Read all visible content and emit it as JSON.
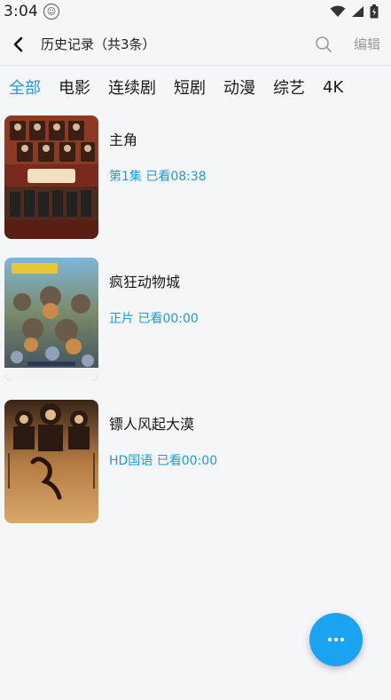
{
  "status_bar": {
    "time": "3:04"
  },
  "header": {
    "title": "历史记录（共3条）",
    "edit_label": "编辑"
  },
  "tabs": [
    {
      "label": "全部",
      "active": true
    },
    {
      "label": "电影",
      "active": false
    },
    {
      "label": "连续剧",
      "active": false
    },
    {
      "label": "短剧",
      "active": false
    },
    {
      "label": "动漫",
      "active": false
    },
    {
      "label": "综艺",
      "active": false
    },
    {
      "label": "4K",
      "active": false
    }
  ],
  "items": [
    {
      "title": "主角",
      "progress": "第1集 已看08:38",
      "poster_text": "5月10日起"
    },
    {
      "title": "疯狂动物城",
      "progress": "正片 已看00:00",
      "poster_text": "疯狂动物城"
    },
    {
      "title": "镖人风起大漠",
      "progress": "HD国语  已看00:00",
      "poster_text": "镖人"
    }
  ],
  "colors": {
    "accent": "#1e9bd7",
    "fab": "#1aa3f0",
    "background": "#f5f6f8"
  }
}
